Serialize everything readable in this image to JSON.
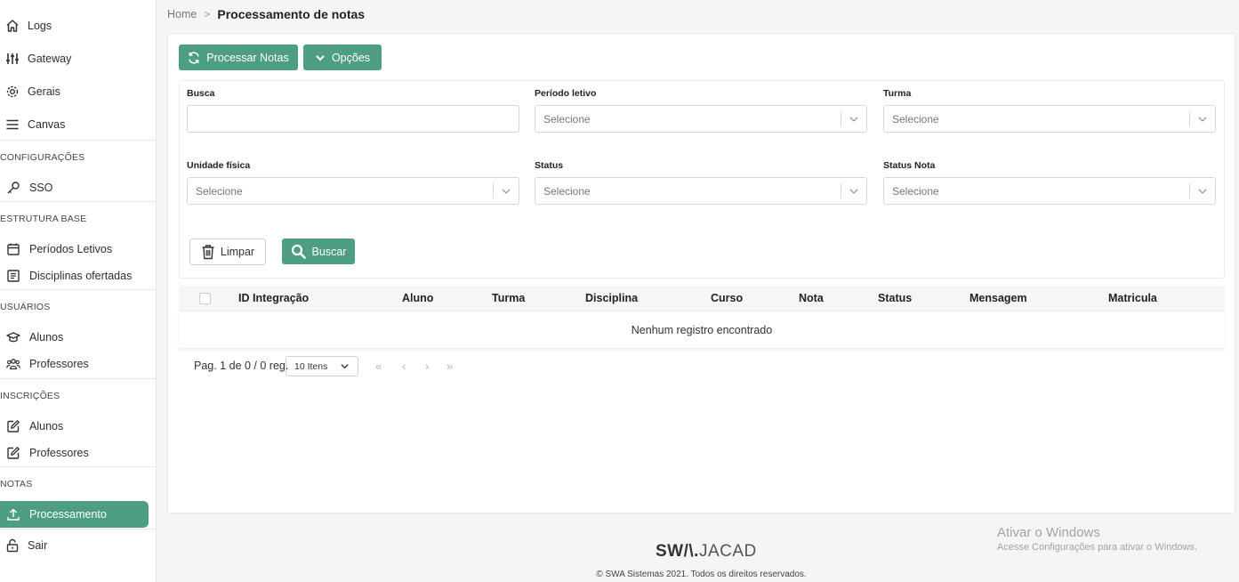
{
  "sidebar": {
    "items": [
      {
        "label": "Logs",
        "icon": "home-icon"
      },
      {
        "label": "Gateway",
        "icon": "sliders-icon"
      },
      {
        "label": "Gerais",
        "icon": "gear-icon"
      },
      {
        "label": "Canvas",
        "icon": "menu-icon"
      }
    ],
    "sections": [
      {
        "title": "CONFIGURAÇÕES",
        "items": [
          {
            "label": "SSO",
            "icon": "key-icon"
          }
        ]
      },
      {
        "title": "ESTRUTURA BASE",
        "items": [
          {
            "label": "Períodos Letivos",
            "icon": "calendar-icon"
          },
          {
            "label": "Disciplinas ofertadas",
            "icon": "book-icon"
          }
        ]
      },
      {
        "title": "USUÁRIOS",
        "items": [
          {
            "label": "Alunos",
            "icon": "graduation-cap-icon"
          },
          {
            "label": "Professores",
            "icon": "users-icon"
          }
        ]
      },
      {
        "title": "INSCRIÇÕES",
        "items": [
          {
            "label": "Alunos",
            "icon": "edit-icon"
          },
          {
            "label": "Professores",
            "icon": "edit-icon"
          }
        ]
      },
      {
        "title": "NOTAS",
        "items": [
          {
            "label": "Processamento",
            "icon": "upload-icon",
            "active": true
          }
        ]
      }
    ],
    "logout": {
      "label": "Sair",
      "icon": "lock-icon"
    }
  },
  "breadcrumb": {
    "home": "Home",
    "separator": ">",
    "current": "Processamento de notas"
  },
  "toolbar": {
    "process_label": "Processar Notas",
    "options_label": "Opções"
  },
  "filters": {
    "busca": {
      "label": "Busca",
      "value": ""
    },
    "periodo": {
      "label": "Período letivo",
      "placeholder": "Selecione"
    },
    "turma": {
      "label": "Turma",
      "placeholder": "Selecione"
    },
    "unidade": {
      "label": "Unidade física",
      "placeholder": "Selecione"
    },
    "status": {
      "label": "Status",
      "placeholder": "Selecione"
    },
    "status_nota": {
      "label": "Status Nota",
      "placeholder": "Selecione"
    }
  },
  "actions": {
    "clear_label": "Limpar",
    "search_label": "Buscar"
  },
  "table": {
    "columns": [
      "ID Integração",
      "Aluno",
      "Turma",
      "Disciplina",
      "Curso",
      "Nota",
      "Status",
      "Mensagem",
      "Matricula"
    ],
    "empty_message": "Nenhum registro encontrado"
  },
  "pagination": {
    "summary": "Pag. 1 de 0 / 0 reg.",
    "page_size": "10 Itens",
    "first": "«",
    "prev": "‹",
    "next": "›",
    "last": "»"
  },
  "footer": {
    "logo_bold": "SW/\\.",
    "logo_light": "JACAD",
    "copyright": "© SWA Sistemas 2021. Todos os direitos reservados."
  },
  "windows_watermark": {
    "title": "Ativar o Windows",
    "subtitle": "Acesse Configurações para ativar o Windows."
  },
  "colors": {
    "accent": "#4e9e86",
    "background": "#f4f5f7"
  }
}
